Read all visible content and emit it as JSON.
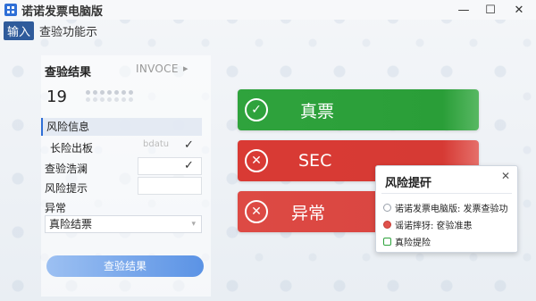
{
  "window": {
    "title": "诺诺发票电脑版",
    "minimize": "—",
    "maximize": "☐",
    "close": "✕"
  },
  "toolbar": {
    "input_tag": "输入",
    "label": "查验功能示"
  },
  "left": {
    "result_header": "查验结果",
    "invoice_tag": "INVOCE",
    "invoice_arrow": "▸",
    "number": "19",
    "risk_info": "风险信息",
    "rows": [
      {
        "label": "长险出板",
        "value": "bdatu",
        "checked": true
      },
      {
        "label": "查验浩澜",
        "value": "",
        "checked": true
      },
      {
        "label": "风险提示",
        "value": ""
      }
    ],
    "abnormal_label": "异常",
    "select_value": "真险结票",
    "select_caret": "▾",
    "query_button": "查验结果"
  },
  "status": {
    "genuine": "真票",
    "sec": "SEC",
    "abnormal": "异常",
    "genuine_icon": "✓",
    "x_icon": "✕",
    "colors": {
      "green": "#2fa33d",
      "red": "#d93a34"
    }
  },
  "popup": {
    "title": "风险提矸",
    "close": "✕",
    "items": [
      {
        "text": "诺诺发票电脑版: 发票查验功",
        "color": "#9aa1ab"
      },
      {
        "text": "谣诺摔犽: 奁验准患",
        "color": "#e0514b"
      },
      {
        "text": "真险提险",
        "color": "#2fa33d"
      }
    ]
  }
}
